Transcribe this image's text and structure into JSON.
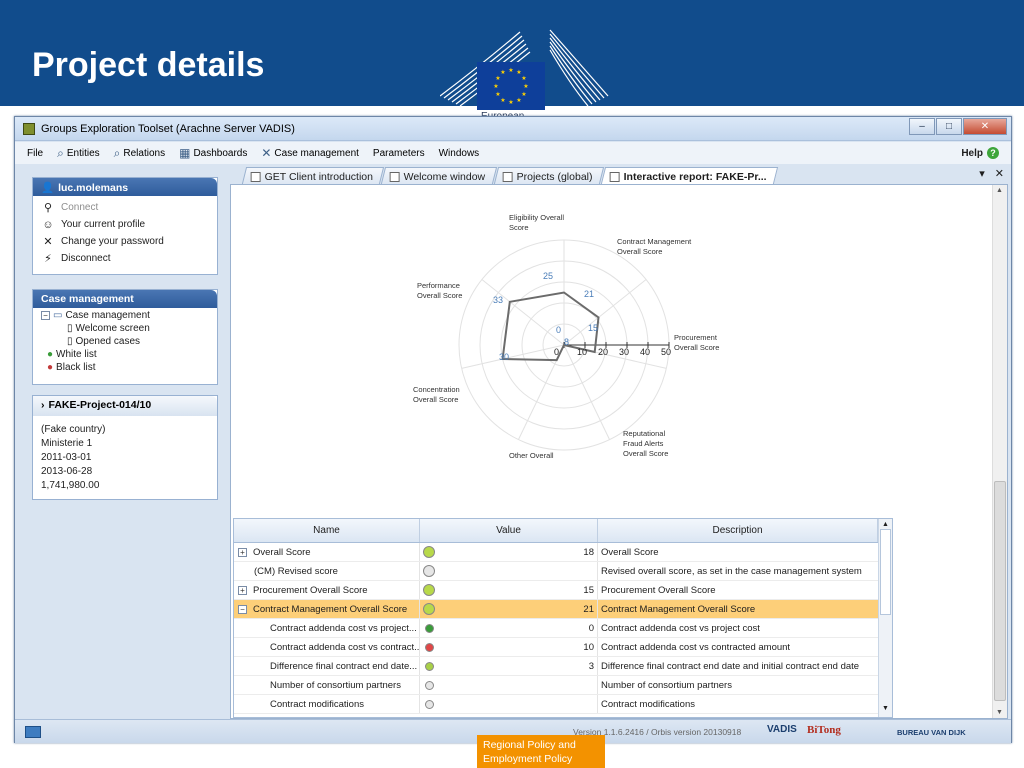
{
  "slide": {
    "title": "Project details",
    "ec_text": "European",
    "bottom_text_1": "Regional Policy and",
    "bottom_text_2": "Employment Policy"
  },
  "window": {
    "title": "Groups Exploration Toolset (Arachne Server VADIS)",
    "minimize": "–",
    "maximize": "□",
    "close": "✕"
  },
  "menu": {
    "items": [
      {
        "label": "File",
        "icon": ""
      },
      {
        "label": "Entities",
        "icon": "search-icon"
      },
      {
        "label": "Relations",
        "icon": "search-icon"
      },
      {
        "label": "Dashboards",
        "icon": "dashboard-icon"
      },
      {
        "label": "Case management",
        "icon": "tools-icon"
      },
      {
        "label": "Parameters",
        "icon": ""
      },
      {
        "label": "Windows",
        "icon": ""
      }
    ],
    "help": "Help"
  },
  "user_panel": {
    "username": "luc.molemans",
    "items": [
      "Connect",
      "Your current profile",
      "Change your password",
      "Disconnect"
    ]
  },
  "case_panel": {
    "title": "Case management",
    "tree": [
      "Case management",
      "Welcome screen",
      "Opened cases",
      "White list",
      "Black list"
    ]
  },
  "project_panel": {
    "title": "FAKE-Project-014/10",
    "lines": [
      "(Fake country)",
      "Ministerie 1",
      "2011-03-01",
      "2013-06-28",
      "1,741,980.00"
    ]
  },
  "tabs": [
    "GET Client introduction",
    "Welcome window",
    "Projects (global)",
    "Interactive report: FAKE-Pr..."
  ],
  "chart_data": {
    "type": "radar",
    "axes": [
      "Eligibility Overall Score",
      "Contract Management Overall Score",
      "Procurement Overall Score",
      "Reputational Fraud Alerts Overall Score",
      "Other Overall",
      "Concentration Overall Score",
      "Performance Overall Score"
    ],
    "values": [
      25,
      21,
      15,
      0,
      8,
      30,
      33
    ],
    "rlim": [
      0,
      50
    ],
    "ticks": [
      0,
      10,
      20,
      30,
      40,
      50
    ],
    "grid": true
  },
  "table": {
    "headers": [
      "Name",
      "Value",
      "Description"
    ],
    "rows": [
      {
        "name": "Overall Score",
        "value": "18",
        "desc": "Overall Score",
        "status": "#b8d94a",
        "expander": "+",
        "indent": false,
        "selected": false
      },
      {
        "name": "(CM) Revised score",
        "value": "",
        "desc": "Revised overall score, as set in the case management system",
        "status": "#e6e6e6",
        "expander": "",
        "indent": false,
        "selected": false
      },
      {
        "name": "Procurement Overall Score",
        "value": "15",
        "desc": "Procurement Overall Score",
        "status": "#b8d94a",
        "expander": "+",
        "indent": false,
        "selected": false
      },
      {
        "name": "Contract Management Overall Score",
        "value": "21",
        "desc": "Contract Management Overall Score",
        "status": "#b8d94a",
        "expander": "−",
        "indent": false,
        "selected": true
      },
      {
        "name": "Contract addenda cost vs project...",
        "value": "0",
        "desc": "Contract addenda cost vs project cost",
        "status": "#3a9c3a",
        "expander": "",
        "indent": true,
        "selected": false
      },
      {
        "name": "Contract addenda cost vs contract...",
        "value": "10",
        "desc": "Contract addenda cost vs contracted amount",
        "status": "#e04747",
        "expander": "",
        "indent": true,
        "selected": false
      },
      {
        "name": "Difference final contract end date...",
        "value": "3",
        "desc": "Difference final contract end date and initial contract end date",
        "status": "#a9d048",
        "expander": "",
        "indent": true,
        "selected": false
      },
      {
        "name": "Number of consortium partners",
        "value": "",
        "desc": "Number of consortium partners",
        "status": "#e6e6e6",
        "expander": "",
        "indent": true,
        "selected": false
      },
      {
        "name": "Contract modifications",
        "value": "",
        "desc": "Contract modifications",
        "status": "#e6e6e6",
        "expander": "",
        "indent": true,
        "selected": false
      }
    ]
  },
  "status": {
    "version": "Version 1.1.6.2416 / Orbis version 20130918",
    "brand1": "VADIS",
    "brand2": "BiTong",
    "brand3": "BUREAU VAN DIJK"
  }
}
